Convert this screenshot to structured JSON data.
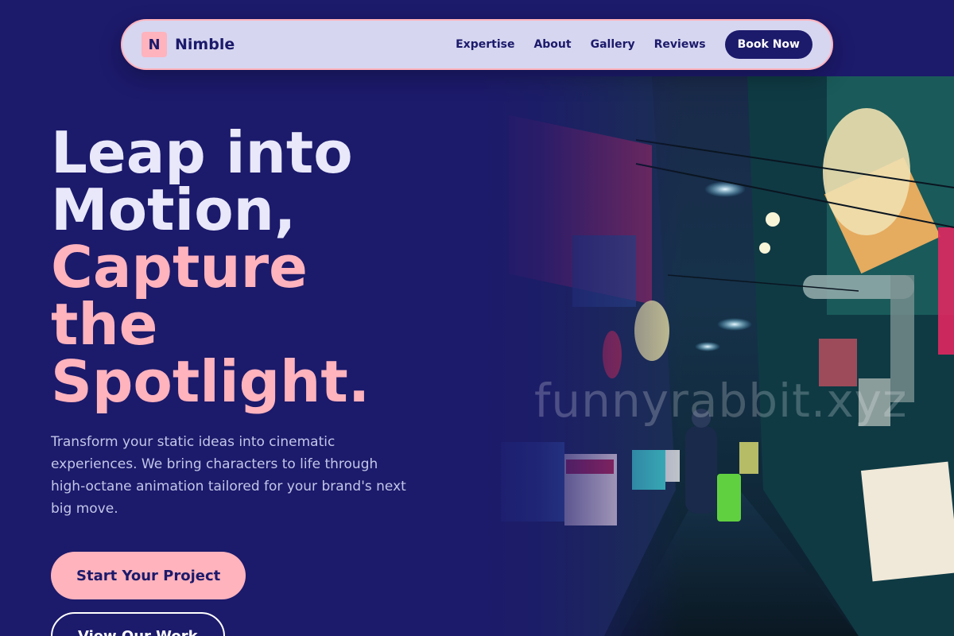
{
  "nav": {
    "logo_mark": "N",
    "brand": "Nimble",
    "links": [
      "Expertise",
      "About",
      "Gallery",
      "Reviews"
    ],
    "cta": "Book Now"
  },
  "hero": {
    "headline_lines": [
      "Leap into",
      "Motion,",
      "Capture",
      "the",
      "Spotlight."
    ],
    "description": "Transform your static ideas into cinematic experiences. We bring characters to life through high-octane animation tailored for your brand's next big move.",
    "primary_cta": "Start Your Project",
    "secondary_cta": "View Our Work",
    "image_watermark": "funnyrabbit.xyz"
  },
  "colors": {
    "background": "#1c1a6b",
    "accent": "#ffb3bd",
    "nav_bg": "#d6d6f0",
    "headline_light": "#e8e8fa"
  },
  "icons": {
    "hero_image": "neon-alley-photo"
  }
}
